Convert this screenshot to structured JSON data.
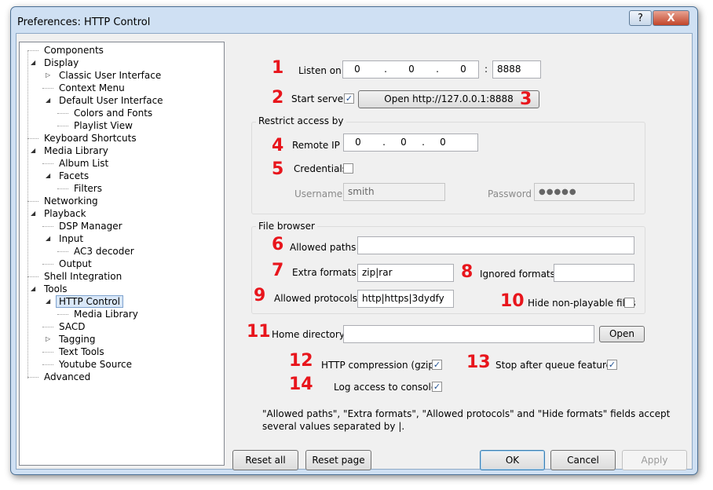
{
  "window": {
    "title": "Preferences: HTTP Control",
    "help_label": "?",
    "close_label": "X"
  },
  "tree": [
    {
      "label": "Components",
      "level": 0,
      "toggle": ""
    },
    {
      "label": "Display",
      "level": 0,
      "toggle": "open"
    },
    {
      "label": "Classic User Interface",
      "level": 1,
      "toggle": "closed"
    },
    {
      "label": "Context Menu",
      "level": 1,
      "toggle": ""
    },
    {
      "label": "Default User Interface",
      "level": 1,
      "toggle": "open"
    },
    {
      "label": "Colors and Fonts",
      "level": 2,
      "toggle": ""
    },
    {
      "label": "Playlist View",
      "level": 2,
      "toggle": ""
    },
    {
      "label": "Keyboard Shortcuts",
      "level": 0,
      "toggle": ""
    },
    {
      "label": "Media Library",
      "level": 0,
      "toggle": "open"
    },
    {
      "label": "Album List",
      "level": 1,
      "toggle": ""
    },
    {
      "label": "Facets",
      "level": 1,
      "toggle": "open"
    },
    {
      "label": "Filters",
      "level": 2,
      "toggle": ""
    },
    {
      "label": "Networking",
      "level": 0,
      "toggle": ""
    },
    {
      "label": "Playback",
      "level": 0,
      "toggle": "open"
    },
    {
      "label": "DSP Manager",
      "level": 1,
      "toggle": ""
    },
    {
      "label": "Input",
      "level": 1,
      "toggle": "open"
    },
    {
      "label": "AC3 decoder",
      "level": 2,
      "toggle": ""
    },
    {
      "label": "Output",
      "level": 1,
      "toggle": ""
    },
    {
      "label": "Shell Integration",
      "level": 0,
      "toggle": ""
    },
    {
      "label": "Tools",
      "level": 0,
      "toggle": "open"
    },
    {
      "label": "HTTP Control",
      "level": 1,
      "toggle": "open",
      "selected": true
    },
    {
      "label": "Media Library",
      "level": 2,
      "toggle": ""
    },
    {
      "label": "SACD",
      "level": 1,
      "toggle": ""
    },
    {
      "label": "Tagging",
      "level": 1,
      "toggle": "closed"
    },
    {
      "label": "Text Tools",
      "level": 1,
      "toggle": ""
    },
    {
      "label": "Youtube Source",
      "level": 1,
      "toggle": ""
    },
    {
      "label": "Advanced",
      "level": 0,
      "toggle": ""
    }
  ],
  "markers": [
    "1",
    "2",
    "3",
    "4",
    "5",
    "6",
    "7",
    "8",
    "9",
    "10",
    "11",
    "12",
    "13",
    "14"
  ],
  "listen": {
    "label": "Listen on",
    "ip": [
      "0",
      "0",
      "0",
      "0"
    ],
    "colon": ":",
    "port": "8888"
  },
  "server": {
    "label": "Start server",
    "checked": true,
    "open_button": "Open http://127.0.0.1:8888"
  },
  "restrict": {
    "title": "Restrict access by",
    "remote_ip_label": "Remote IP",
    "remote_ip": [
      "0",
      "0",
      "0",
      "0"
    ],
    "credentials_label": "Credentials",
    "credentials_checked": false,
    "username_label": "Username",
    "username": "smith",
    "password_label": "Password",
    "password": "●●●●●"
  },
  "browser": {
    "title": "File browser",
    "allowed_paths_label": "Allowed paths",
    "allowed_paths": "",
    "extra_formats_label": "Extra formats",
    "extra_formats": "zip|rar",
    "ignored_formats_label": "Ignored formats",
    "ignored_formats": "",
    "allowed_protocols_label": "Allowed protocols",
    "allowed_protocols": "http|https|3dydfy",
    "hide_nonplayable_label": "Hide non-playable files",
    "hide_nonplayable_checked": false
  },
  "home": {
    "label": "Home directory",
    "value": "",
    "open_button": "Open"
  },
  "options": {
    "gzip_label": "HTTP compression (gzip)",
    "gzip_checked": true,
    "stop_queue_label": "Stop after queue feature",
    "stop_queue_checked": true,
    "log_label": "Log access to console",
    "log_checked": true
  },
  "note_line1": "\"Allowed paths\", \"Extra formats\", \"Allowed protocols\" and \"Hide formats\" fields accept",
  "note_line2": "several values separated by |.",
  "footer": {
    "reset_all": "Reset all",
    "reset_page": "Reset page",
    "ok": "OK",
    "cancel": "Cancel",
    "apply": "Apply"
  }
}
